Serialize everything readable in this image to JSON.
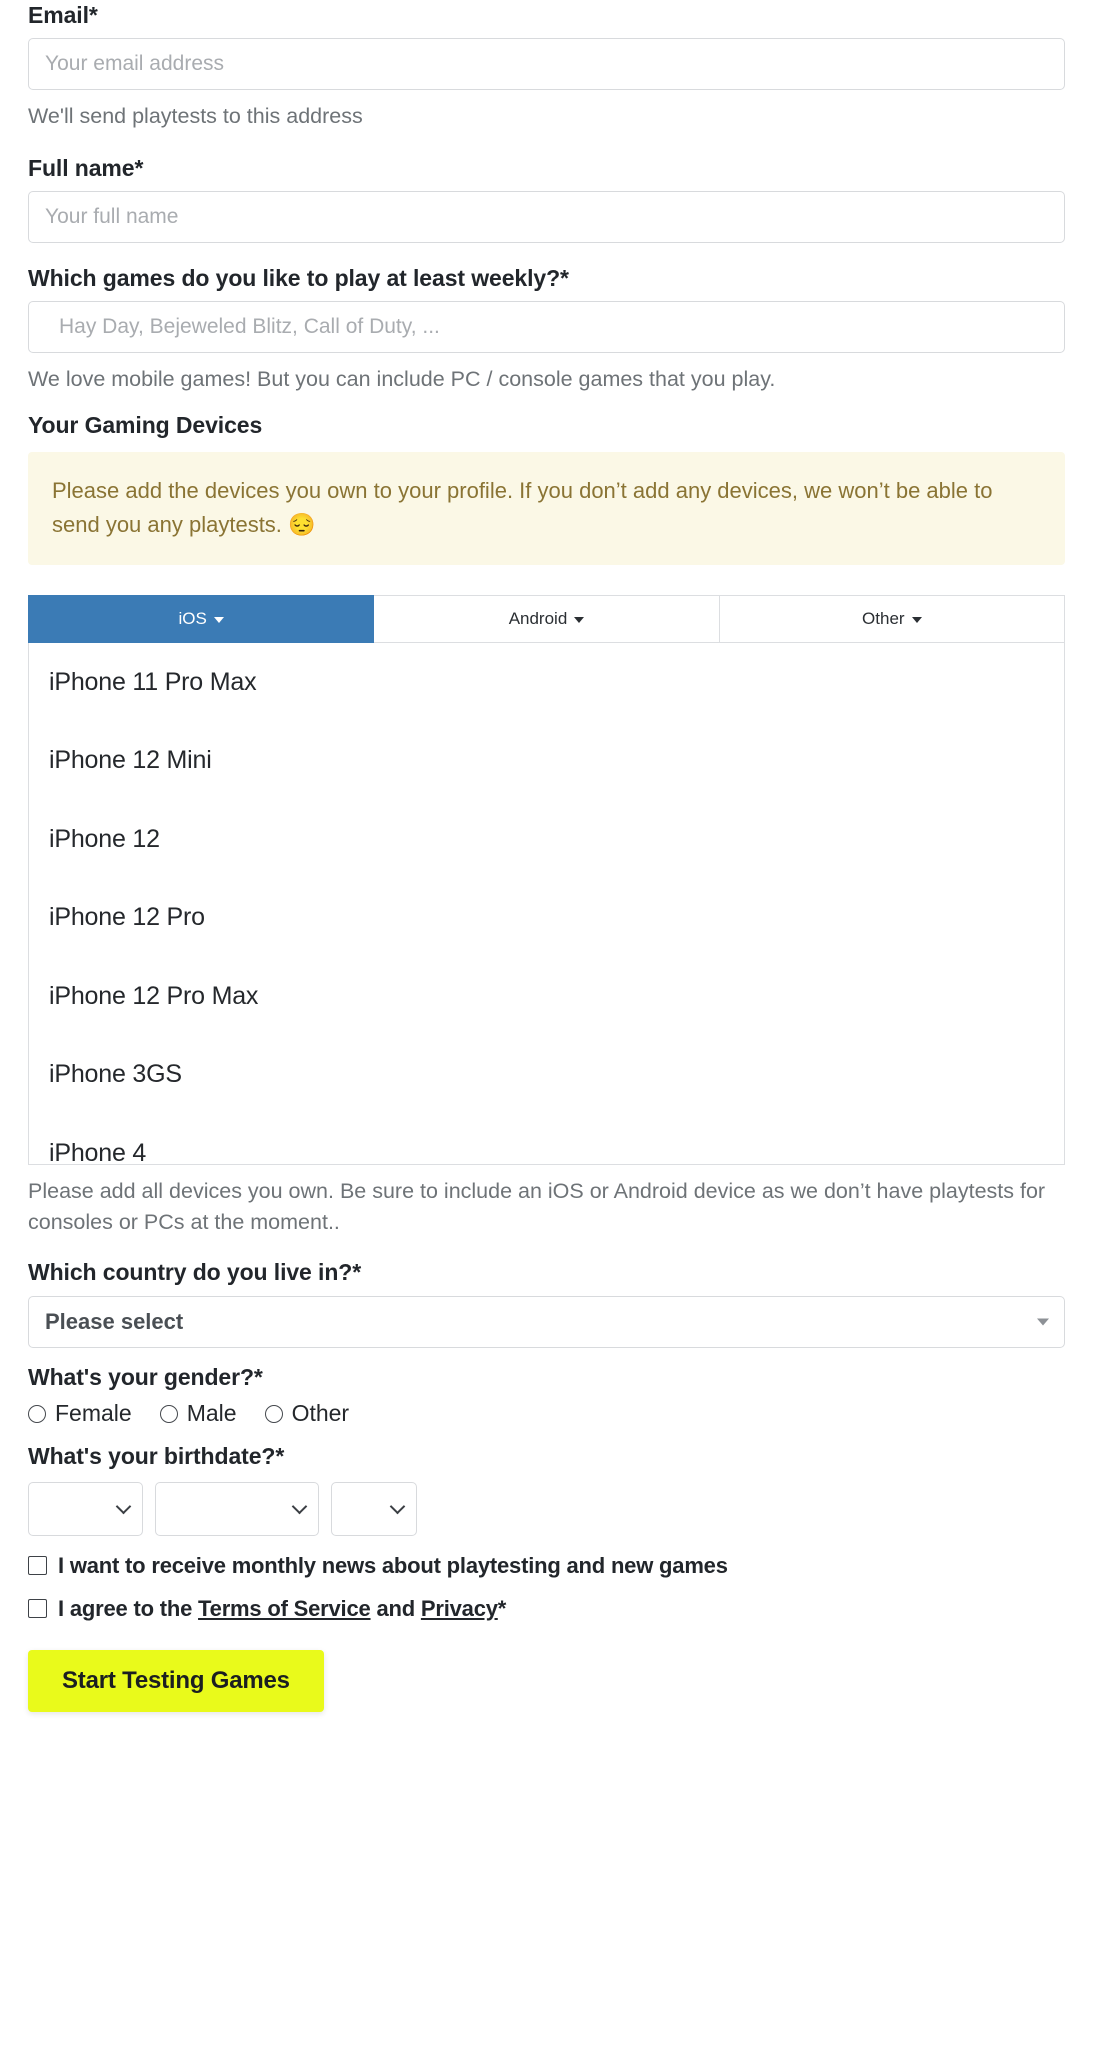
{
  "email": {
    "label": "Email*",
    "placeholder": "Your email address",
    "value": "",
    "help": "We'll send playtests to this address"
  },
  "full_name": {
    "label": "Full name*",
    "placeholder": "Your full name",
    "value": ""
  },
  "games": {
    "label": "Which games do you like to play at least weekly?*",
    "placeholder": "Hay Day, Bejeweled Blitz, Call of Duty, ...",
    "value": "",
    "help": "We love mobile games! But you can include PC / console games that you play."
  },
  "devices": {
    "label": "Your Gaming Devices",
    "alert": "Please add the devices you own to your profile. If you don’t add any devices, we won’t be able to send you any playtests. 😔",
    "tabs": [
      {
        "label": "iOS",
        "active": true
      },
      {
        "label": "Android",
        "active": false
      },
      {
        "label": "Other",
        "active": false
      }
    ],
    "items": [
      "iPhone 11 Pro Max",
      "iPhone 12 Mini",
      "iPhone 12",
      "iPhone 12 Pro",
      "iPhone 12 Pro Max",
      "iPhone 3GS",
      "iPhone 4"
    ],
    "help": "Please add all devices you own. Be sure to include an iOS or Android device as we don’t have playtests for consoles or PCs at the moment.."
  },
  "country": {
    "label": "Which country do you live in?*",
    "selected": "Please select"
  },
  "gender": {
    "label": "What's your gender?*",
    "options": [
      "Female",
      "Male",
      "Other"
    ],
    "selected": ""
  },
  "birthdate": {
    "label": "What's your birthdate?*",
    "day": "",
    "month": "",
    "year": ""
  },
  "consents": {
    "newsletter": "I want to receive monthly news about playtesting and new games",
    "terms_prefix": "I agree to the ",
    "terms_link": "Terms of Service",
    "terms_middle": " and ",
    "privacy_link": "Privacy",
    "terms_suffix": "*"
  },
  "submit": {
    "label": "Start Testing Games"
  },
  "colors": {
    "accent_blue": "#3b7bb5",
    "submit_yellow": "#e9fa1b",
    "alert_bg": "#fbf8e6",
    "alert_text": "#8a7434"
  }
}
